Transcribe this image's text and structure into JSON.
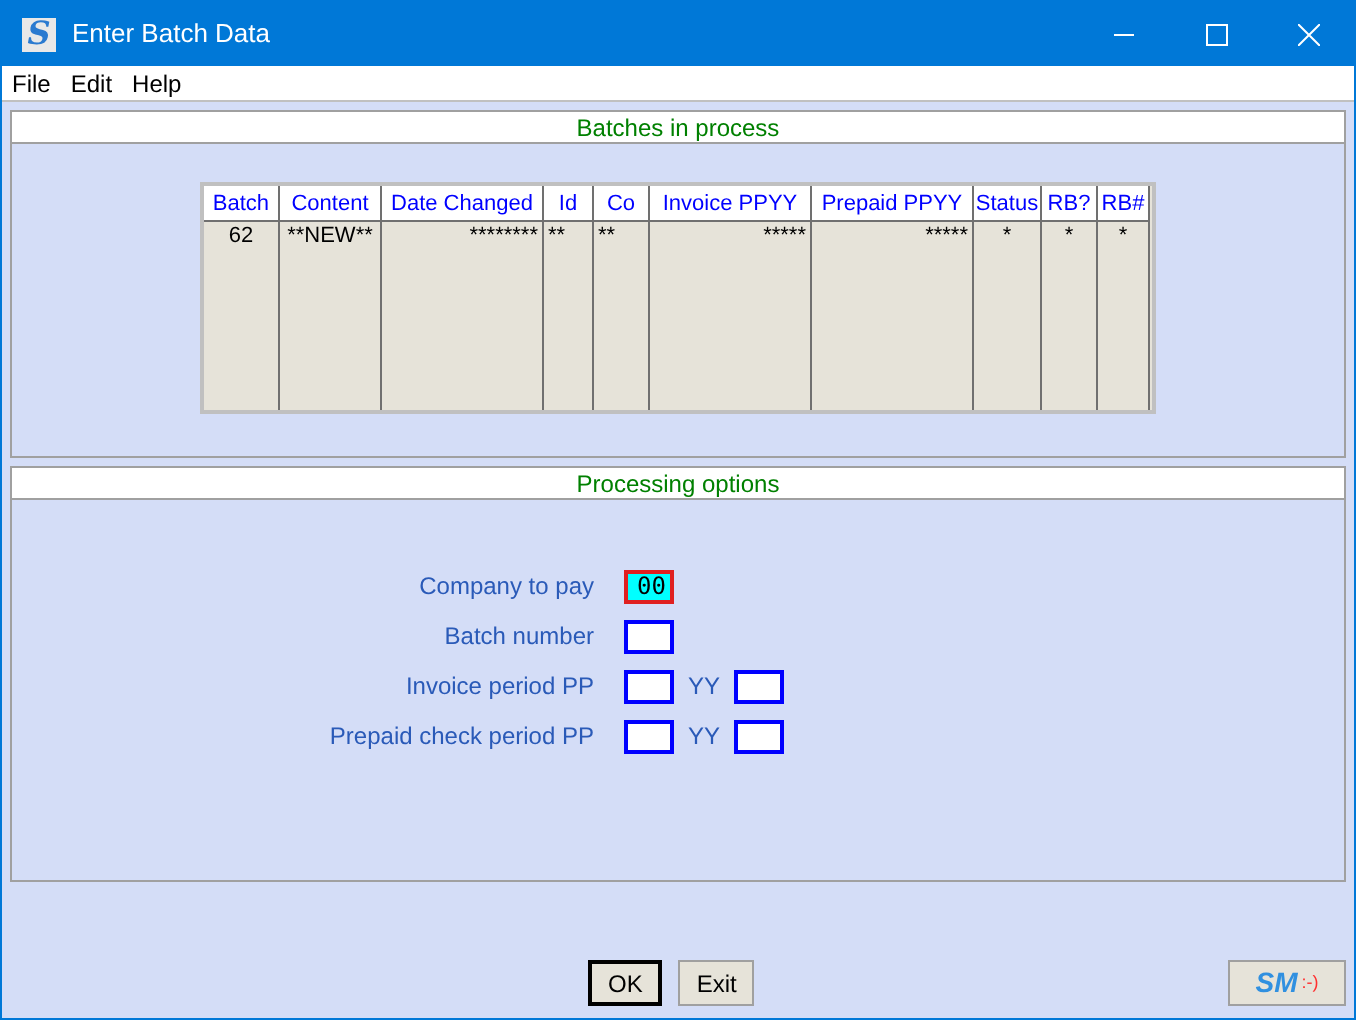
{
  "window": {
    "title": "Enter Batch Data",
    "icon_letter": "S"
  },
  "menu": [
    {
      "label": "File"
    },
    {
      "label": "Edit"
    },
    {
      "label": "Help"
    }
  ],
  "batches": {
    "title": "Batches in process",
    "table": {
      "columns": [
        {
          "label": "Batch"
        },
        {
          "label": "Content"
        },
        {
          "label": "Date Changed"
        },
        {
          "label": "Id"
        },
        {
          "label": "Co"
        },
        {
          "label": "Invoice PPYY"
        },
        {
          "label": "Prepaid PPYY"
        },
        {
          "label": "Status"
        },
        {
          "label": "RB?"
        },
        {
          "label": "RB#"
        }
      ],
      "rows": [
        [
          "62",
          "**NEW**",
          "********",
          "**",
          "**",
          "*****",
          "*****",
          "*",
          "*",
          "*"
        ]
      ]
    }
  },
  "options": {
    "title": "Processing options",
    "fields": [
      {
        "label": "Company to pay",
        "inputs": [
          {
            "value": "00",
            "focused": true
          }
        ]
      },
      {
        "label": "Batch number",
        "inputs": [
          {
            "focused": false
          }
        ]
      },
      {
        "label": "Invoice period PP",
        "inputs": [
          {
            "focused": false
          },
          {
            "label": "YY",
            "focused": false
          }
        ]
      },
      {
        "label": "Prepaid check period PP",
        "inputs": [
          {
            "focused": false
          },
          {
            "label": "YY",
            "focused": false
          }
        ]
      }
    ]
  },
  "buttons": [
    {
      "label": "OK",
      "default": true
    },
    {
      "label": "Exit",
      "default": false
    }
  ],
  "logo_button": {
    "text": "SM",
    "smiley": ":-)"
  }
}
